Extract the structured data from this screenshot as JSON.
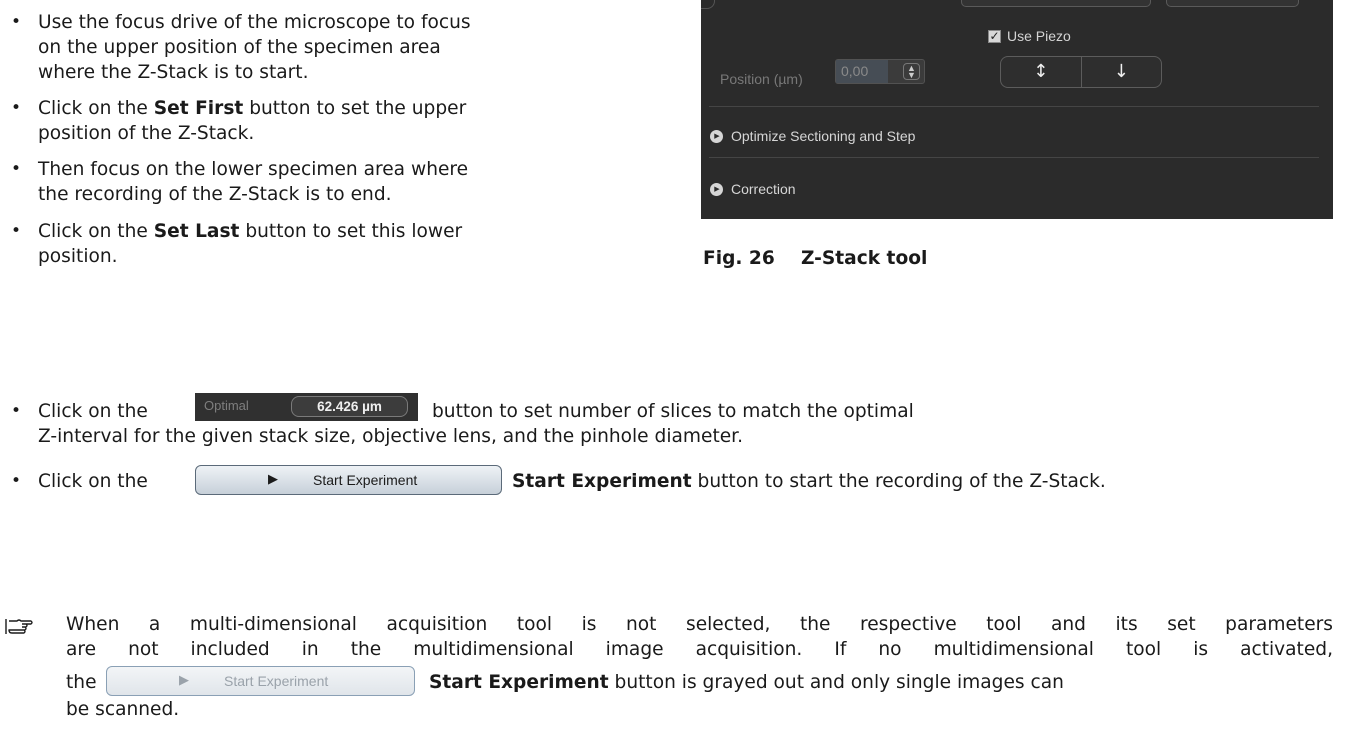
{
  "bullets": {
    "b1_line1": "Use the focus drive of the microscope to focus",
    "b1_line2": "on the upper position of the specimen area",
    "b1_line3": "where the Z-Stack is to start.",
    "b2_pre": "Click on the ",
    "b2_bold": "Set First",
    "b2_post": " button to set the upper",
    "b2_line2": "position of the Z-Stack.",
    "b3_line1": "Then focus on the lower specimen area where",
    "b3_line2": "the recording of the Z-Stack is to end.",
    "b4_pre": "Click on the ",
    "b4_bold": "Set Last",
    "b4_post": " button to set this lower",
    "b4_line2": "position.",
    "b5_pre": "Click on the",
    "b5_post": "button to set number of slices to match the optimal",
    "b5_line2": "Z-interval for the given stack size, objective lens, and the pinhole diameter.",
    "b6_pre": "Click on the",
    "b6_bold": "Start Experiment",
    "b6_post": " button to start the recording of the Z-Stack."
  },
  "note": {
    "line1": "When a multi-dimensional acquisition tool is not selected, the respective tool and its set parameters",
    "line2": "are not included in the multidimensional image acquisition. If no multidimensional tool is activated,",
    "line3_pre": "the",
    "line3_bold": "Start Experiment",
    "line3_post": " button is grayed out and only single images can",
    "line4": "be scanned."
  },
  "panel": {
    "use_piezo_label": "Use Piezo",
    "use_piezo_checked": true,
    "position_label": "Position (µm)",
    "position_value": "0,00",
    "sections": [
      "Optimize Sectioning and Step",
      "Correction"
    ]
  },
  "figure": {
    "number": "Fig. 26",
    "title": "Z-Stack tool"
  },
  "optimal_button": {
    "label": "Optimal",
    "value": "62.426 µm"
  },
  "start_button": {
    "label": "Start Experiment"
  },
  "icons": {
    "bullet": "bullet-dot",
    "note": "pointing-hand-icon",
    "updown": "up-down-arrow-icon",
    "down": "down-arrow-icon",
    "section": "expand-circle-icon",
    "play": "play-triangle-icon"
  }
}
